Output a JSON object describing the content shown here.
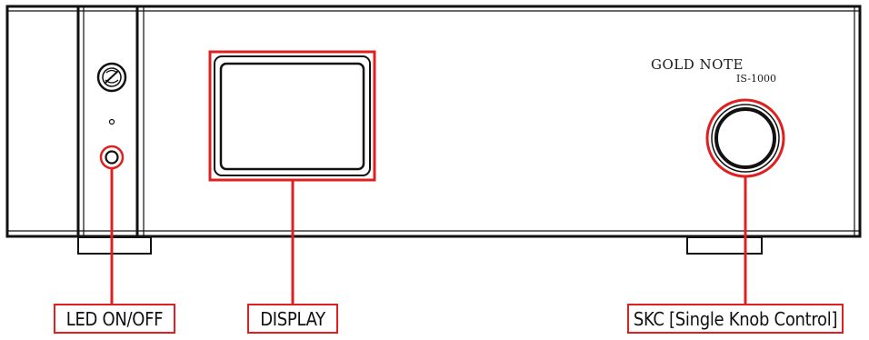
{
  "device": {
    "brand": "GOLD NOTE",
    "model": "IS-1000"
  },
  "callouts": {
    "led": "LED ON/OFF",
    "display": "DISPLAY",
    "knob": "SKC [Single Knob Control]"
  },
  "icons": {
    "power_logo": "no-symbol-icon"
  },
  "colors": {
    "callout": "#e02020",
    "outline": "#111111"
  }
}
